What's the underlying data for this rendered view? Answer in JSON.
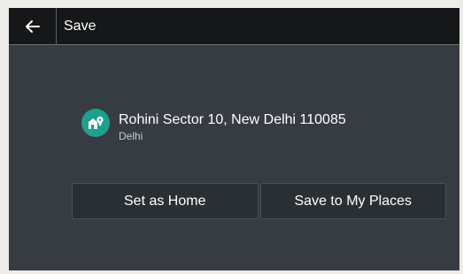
{
  "header": {
    "back_icon": "arrow-left-icon",
    "title": "Save"
  },
  "place": {
    "icon": "home-pin-icon",
    "name": "Rohini Sector 10, New Delhi 110085",
    "subtitle": "Delhi"
  },
  "actions": {
    "set_home_label": "Set as Home",
    "save_places_label": "Save to My Places"
  },
  "colors": {
    "panel_bg": "#363c42",
    "topbar_bg": "#151718",
    "icon_bg": "#1f9f8e",
    "button_bg": "#2a2f33"
  }
}
